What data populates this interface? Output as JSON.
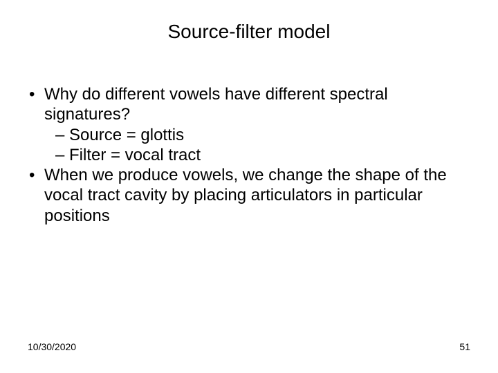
{
  "title": "Source-filter model",
  "bullets": {
    "b1": "Why do different vowels have different spectral signatures?",
    "b1a": "Source = glottis",
    "b1b": "Filter = vocal tract",
    "b2": "When we produce vowels, we change the shape of the vocal tract cavity by placing articulators in particular positions"
  },
  "footer": {
    "date": "10/30/2020",
    "page": "51"
  }
}
